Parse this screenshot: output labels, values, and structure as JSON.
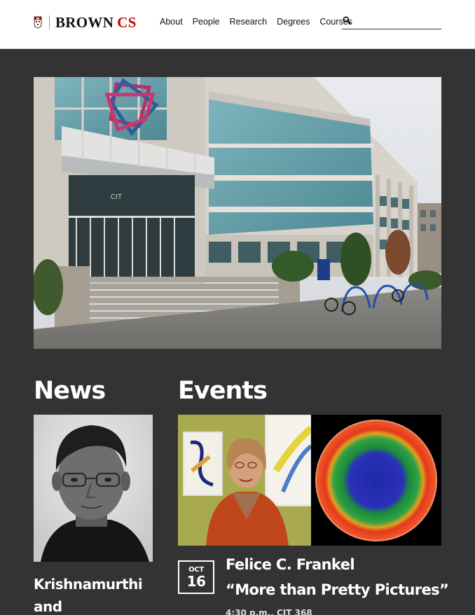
{
  "header": {
    "brand_main": "BROWN",
    "brand_accent": "CS",
    "brand_accent_color": "#c00404",
    "nav": [
      "About",
      "People",
      "Research",
      "Degrees",
      "Courses"
    ],
    "search_placeholder": "",
    "search_icon": "search-icon"
  },
  "hero": {
    "building_sign": "CIT"
  },
  "news": {
    "title": "News",
    "headline": "Krishnamurthi and Collaborators"
  },
  "events": {
    "title": "Events",
    "items": [
      {
        "month": "OCT",
        "day": "16",
        "speaker": "Felice C. Frankel",
        "talk_title": "“More than Pretty Pictures”",
        "meta": "4:30 p.m., CIT 368"
      }
    ]
  },
  "colors": {
    "background": "#333333",
    "header_bg": "#ffffff",
    "accent": "#c00404"
  }
}
